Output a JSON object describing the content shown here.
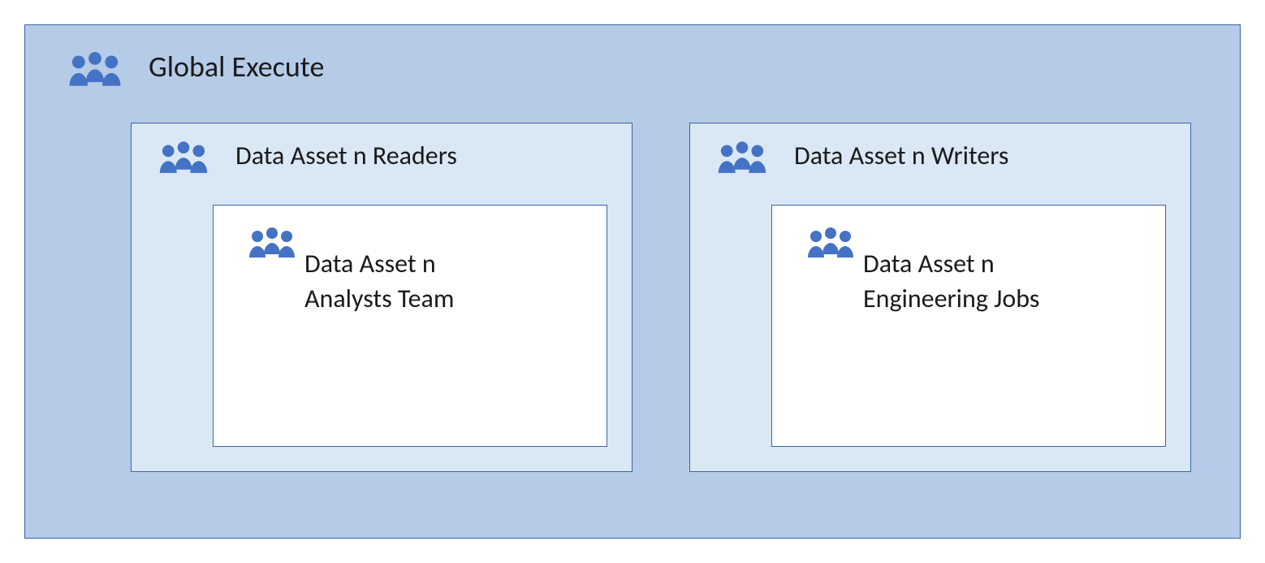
{
  "outer": {
    "title": "Global Execute"
  },
  "mid": [
    {
      "title": "Data Asset n Readers",
      "inner": "Data Asset n\nAnalysts Team"
    },
    {
      "title": "Data Asset n Writers",
      "inner": "Data Asset n\nEngineering Jobs"
    }
  ],
  "colors": {
    "icon": "#4472c4",
    "outerBg": "#b5cbe7",
    "midBg": "#dae7f5",
    "border": "#3a65a6"
  }
}
